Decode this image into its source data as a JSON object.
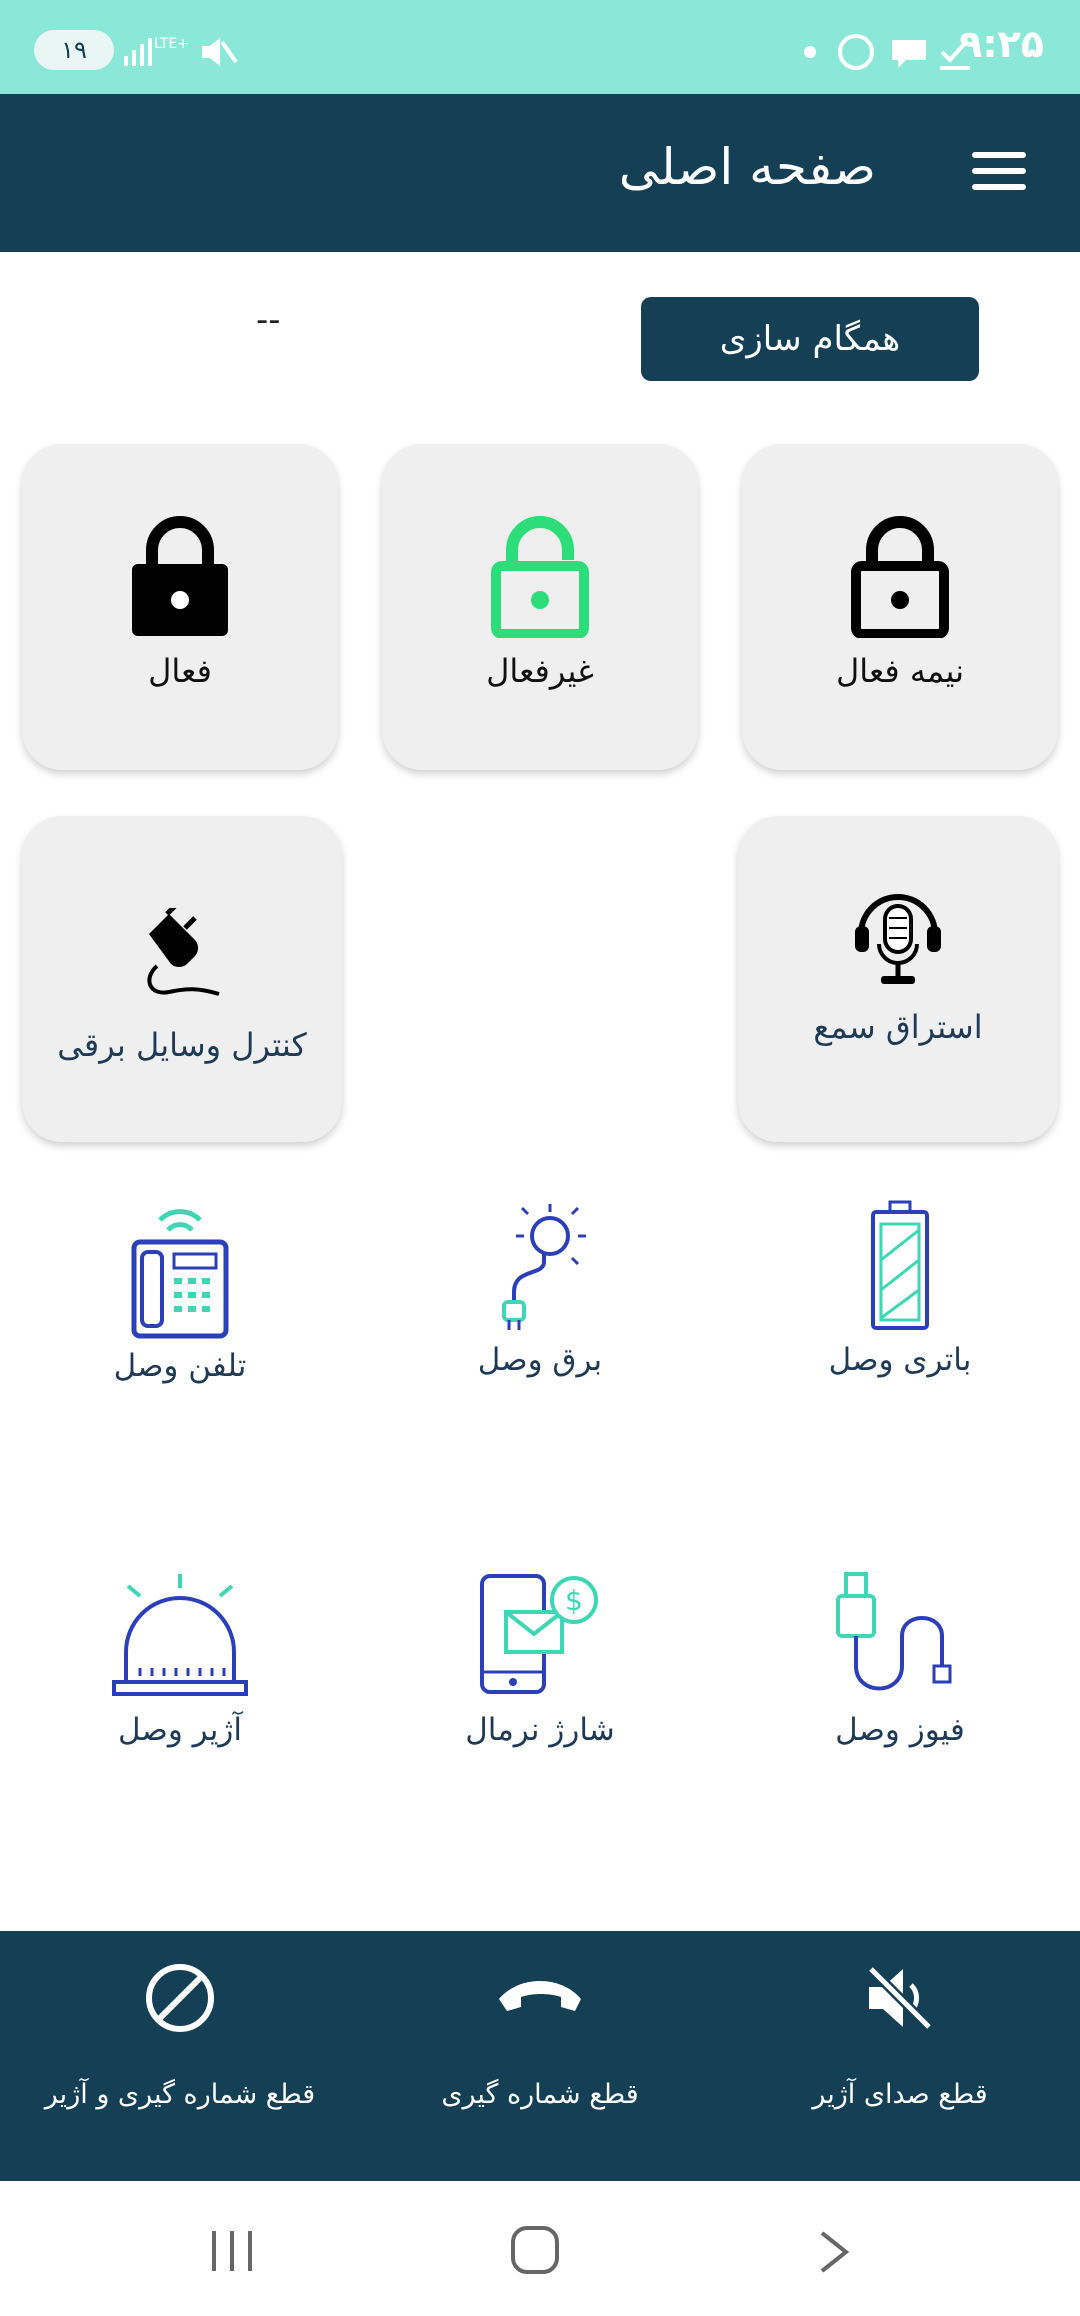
{
  "status_bar": {
    "time": "۹:۲۵",
    "battery": "۱۹"
  },
  "header": {
    "title": "صفحه اصلی"
  },
  "sync": {
    "button_label": "همگام سازی",
    "value": "--"
  },
  "modes": [
    {
      "label": "نیمه فعال"
    },
    {
      "label": "غیرفعال"
    },
    {
      "label": "فعال"
    }
  ],
  "controls": {
    "listen_label": "استراق سمع",
    "power_control_label": "کنترل وسایل برقی"
  },
  "status_tiles": [
    {
      "label": "باتری وصل"
    },
    {
      "label": "برق وصل"
    },
    {
      "label": "تلفن وصل"
    },
    {
      "label": "فیوز وصل"
    },
    {
      "label": "شارژ نرمال"
    },
    {
      "label": "آژیر وصل"
    }
  ],
  "bottom_bar": [
    {
      "label": "قطع صدای آژیر"
    },
    {
      "label": "قطع شماره گیری"
    },
    {
      "label": "قطع شماره گیری و آژیر"
    }
  ],
  "colors": {
    "header": "#143f55",
    "status_bar": "#8be8d8",
    "accent_green": "#2ddd79",
    "tile_blue": "#2b3fb8",
    "tile_teal": "#3ed6b5"
  }
}
